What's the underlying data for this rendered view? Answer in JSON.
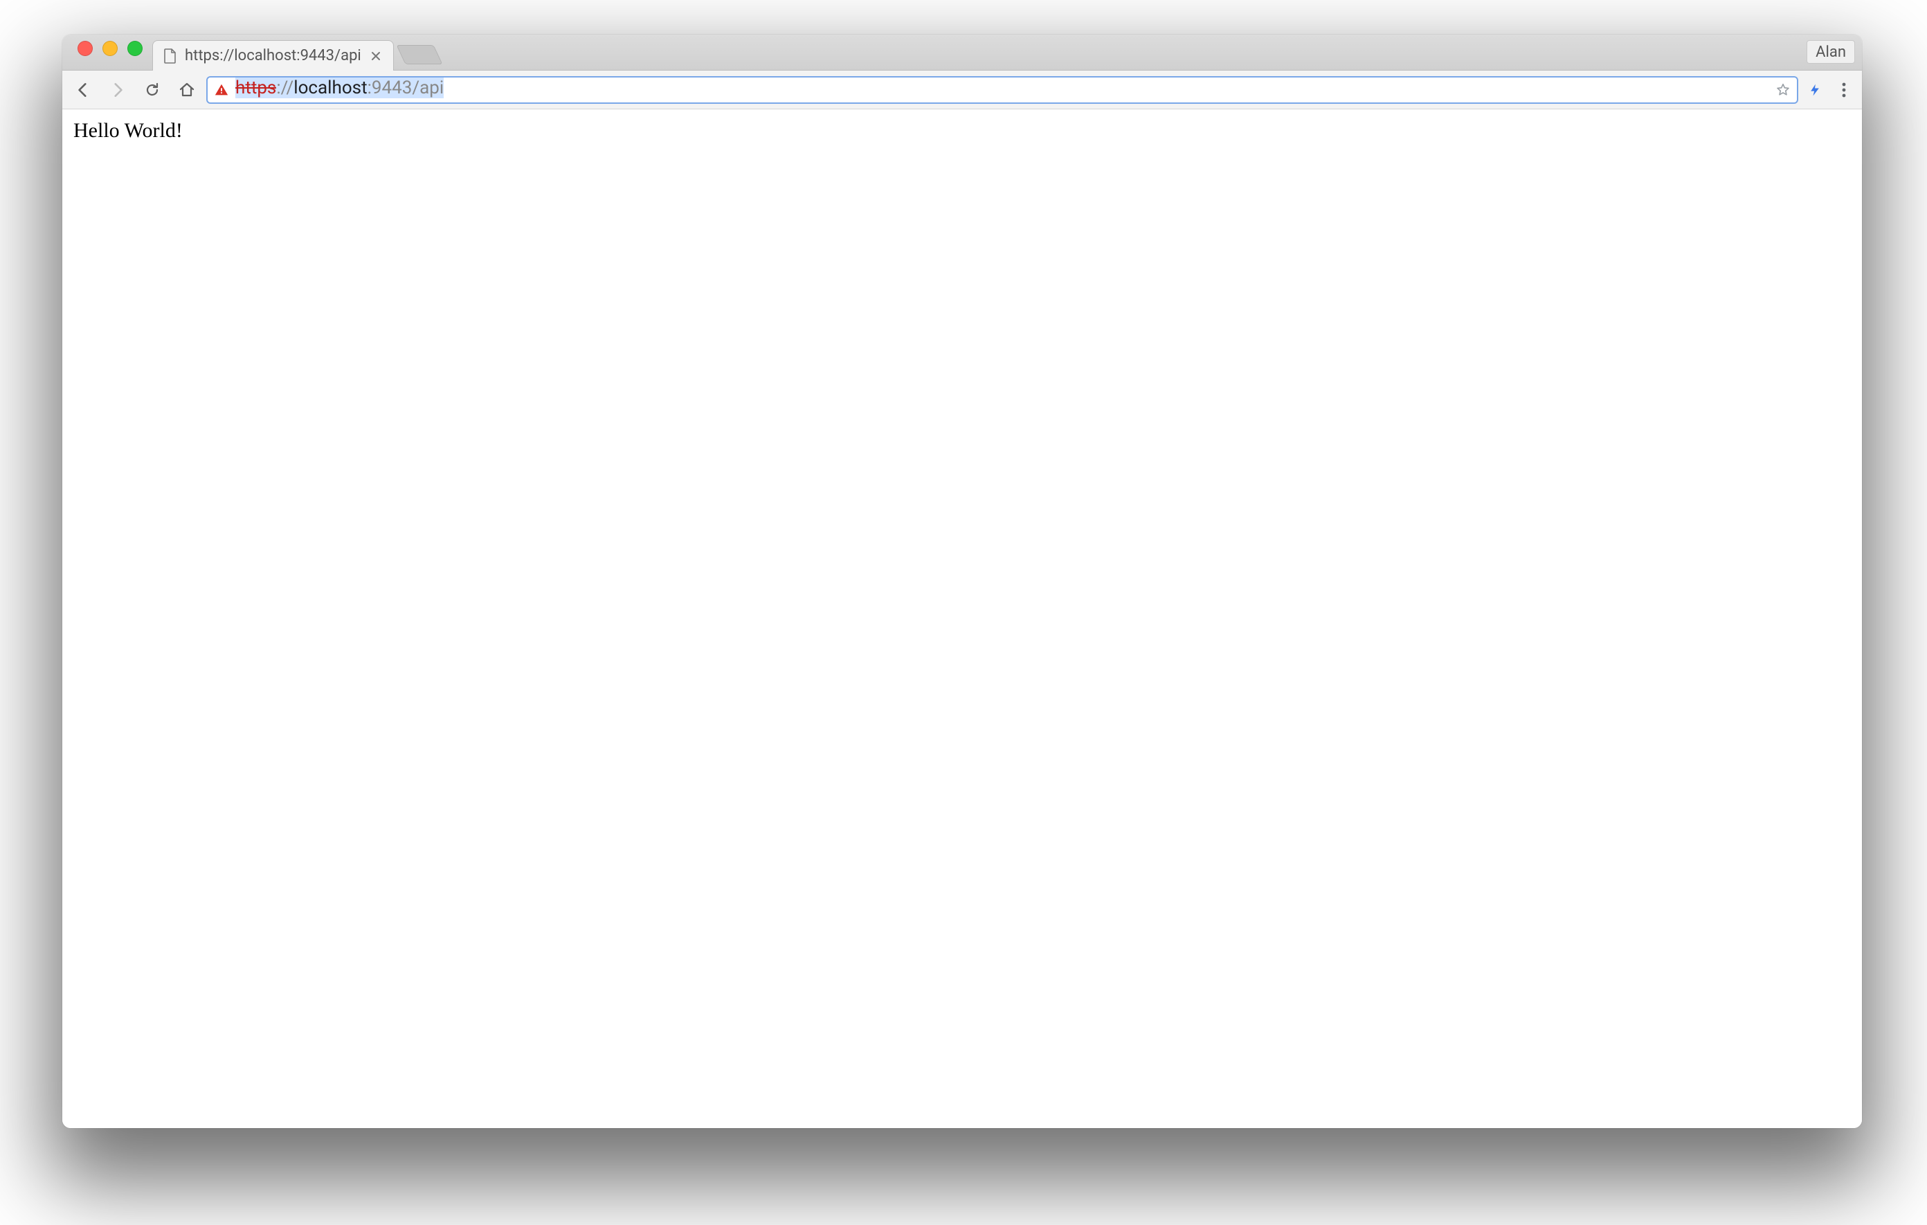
{
  "window": {
    "profile_name": "Alan"
  },
  "tabs": [
    {
      "title": "https://localhost:9443/api",
      "favicon": "file-icon"
    }
  ],
  "omnibox": {
    "security": "not-secure",
    "url": {
      "scheme": "https",
      "sep": "://",
      "host": "localhost",
      "port": ":9443",
      "path": "/api"
    }
  },
  "page": {
    "body_text": "Hello World!"
  },
  "icons": {
    "back": "back-icon",
    "forward": "forward-icon",
    "reload": "reload-icon",
    "home": "home-icon",
    "star": "star-icon",
    "lightning": "lightning-icon",
    "menu": "menu-dots-icon",
    "close": "close-icon",
    "warning": "warning-triangle-icon",
    "file": "file-icon"
  }
}
